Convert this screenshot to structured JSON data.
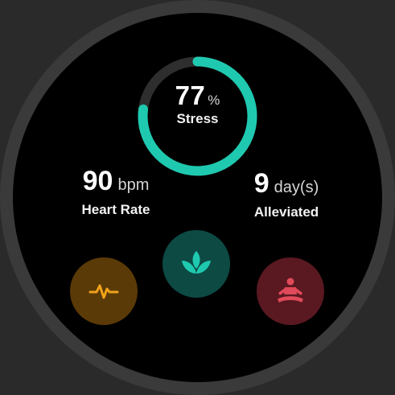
{
  "stress": {
    "value": "77",
    "unit": "%",
    "label": "Stress",
    "fraction": 0.77
  },
  "heart_rate": {
    "value": "90",
    "unit": "bpm",
    "label": "Heart Rate"
  },
  "alleviated": {
    "value": "9",
    "unit": "day(s)",
    "label": "Alleviated"
  },
  "buttons": [
    {
      "name": "heart-rate-button",
      "icon": "pulse-icon",
      "bg": "#5a3a07",
      "fg": "#f0a21a"
    },
    {
      "name": "breathe-button",
      "icon": "lotus-leaf-icon",
      "bg": "#0d4a44",
      "fg": "#1fc9b0"
    },
    {
      "name": "relax-button",
      "icon": "meditation-icon",
      "bg": "#5a1820",
      "fg": "#e04a5a"
    }
  ],
  "colors": {
    "accent": "#1fc9b0",
    "ring_track": "#2a2a2a",
    "background": "#000000"
  }
}
